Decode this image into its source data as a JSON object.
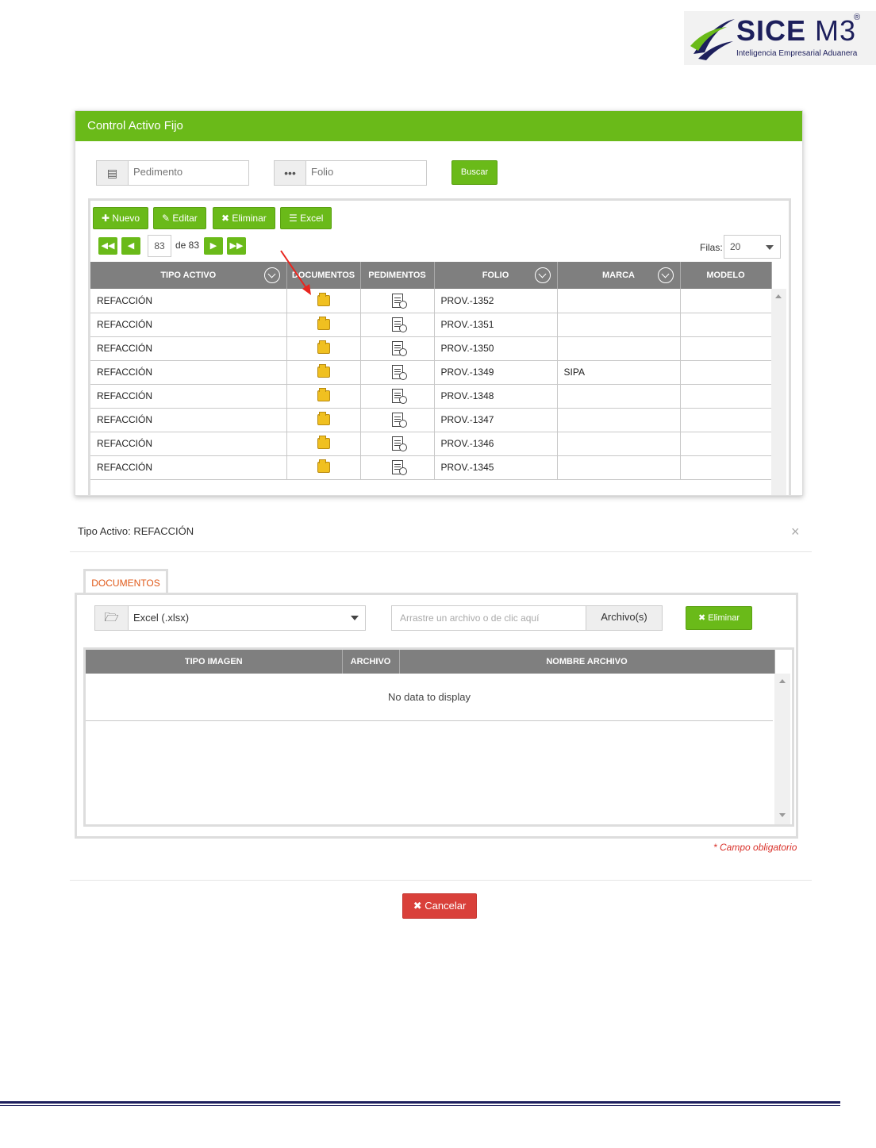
{
  "logo": {
    "title_main": "SICE",
    "title_version": "M3",
    "registered": "®",
    "subtitle": "Inteligencia Empresarial Aduanera"
  },
  "top_window": {
    "title": "Control Activo Fijo",
    "search": {
      "pedimento_placeholder": "Pedimento",
      "folio_placeholder": "Folio",
      "folio_addon": "•••",
      "search_label": "Buscar"
    },
    "toolbar": {
      "new_label": "Nuevo",
      "edit_label": "Editar",
      "delete_label": "Eliminar",
      "excel_label": "Excel"
    },
    "pager": {
      "current_page": "83",
      "of_text": "de 83",
      "rows_label": "Filas:",
      "rows_value": "20"
    },
    "columns": [
      "TIPO ACTIVO",
      "DOCUMENTOS",
      "PEDIMENTOS",
      "FOLIO",
      "MARCA",
      "MODELO"
    ],
    "rows": [
      {
        "tipo": "REFACCIÓN",
        "folio": "PROV.-1352",
        "marca": "",
        "modelo": ""
      },
      {
        "tipo": "REFACCIÓN",
        "folio": "PROV.-1351",
        "marca": "",
        "modelo": ""
      },
      {
        "tipo": "REFACCIÓN",
        "folio": "PROV.-1350",
        "marca": "",
        "modelo": ""
      },
      {
        "tipo": "REFACCIÓN",
        "folio": "PROV.-1349",
        "marca": "SIPA",
        "modelo": ""
      },
      {
        "tipo": "REFACCIÓN",
        "folio": "PROV.-1348",
        "marca": "",
        "modelo": ""
      },
      {
        "tipo": "REFACCIÓN",
        "folio": "PROV.-1347",
        "marca": "",
        "modelo": ""
      },
      {
        "tipo": "REFACCIÓN",
        "folio": "PROV.-1346",
        "marca": "",
        "modelo": ""
      },
      {
        "tipo": "REFACCIÓN",
        "folio": "PROV.-1345",
        "marca": "",
        "modelo": ""
      }
    ]
  },
  "modal": {
    "title": "Tipo Activo: REFACCIÓN",
    "close": "×",
    "tab_label": "DOCUMENTOS",
    "file_type_value": "Excel (.xlsx)",
    "drop_placeholder": "Arrastre un archivo o de clic aquí",
    "files_button": "Archivo(s)",
    "delete_label": "Eliminar",
    "columns": [
      "TIPO IMAGEN",
      "ARCHIVO",
      "NOMBRE ARCHIVO"
    ],
    "empty_text": "No data to display",
    "required_note": "* Campo obligatorio",
    "cancel_label": "Cancelar"
  },
  "colors": {
    "accent_green": "#6aba19",
    "header_gray": "#7f7f7f",
    "danger_red": "#d9403a",
    "brand_navy": "#1d1f5c"
  }
}
